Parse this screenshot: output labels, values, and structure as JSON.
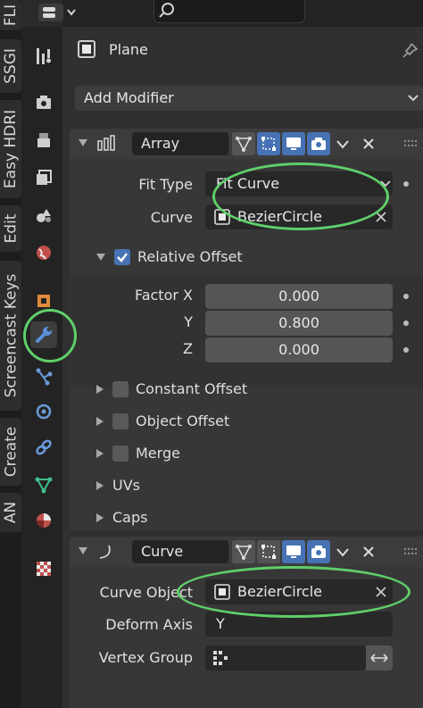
{
  "vertical_tabs": [
    {
      "label": "FLI"
    },
    {
      "label": "SSGI"
    },
    {
      "label": "Easy HDRI"
    },
    {
      "label": "Edit"
    },
    {
      "label": "Screencast Keys"
    },
    {
      "label": "Create"
    },
    {
      "label": "AN"
    }
  ],
  "properties_tabs": [
    "tool-icon",
    "render-icon",
    "output-icon",
    "view-layer-icon",
    "scene-icon",
    "world-icon",
    "object-icon",
    "modifier-wrench-icon",
    "particles-icon",
    "physics-icon",
    "constraints-icon",
    "object-data-icon",
    "material-icon",
    "texture-icon"
  ],
  "active_tab": "modifier-wrench-icon",
  "object": {
    "name": "Plane"
  },
  "add_modifier_label": "Add Modifier",
  "array_modifier": {
    "name": "Array",
    "fit_type_label": "Fit Type",
    "fit_type_value": "Fit Curve",
    "curve_label": "Curve",
    "curve_value": "BezierCircle",
    "relative_offset_label": "Relative Offset",
    "relative_offset_checked": true,
    "factor_x_label": "Factor X",
    "factor_x": "0.000",
    "y_label": "Y",
    "factor_y": "0.800",
    "z_label": "Z",
    "factor_z": "0.000",
    "subpanels": [
      {
        "label": "Constant Offset",
        "checkbox": true
      },
      {
        "label": "Object Offset",
        "checkbox": true
      },
      {
        "label": "Merge",
        "checkbox": true
      },
      {
        "label": "UVs",
        "checkbox": false
      },
      {
        "label": "Caps",
        "checkbox": false
      }
    ]
  },
  "curve_modifier": {
    "name": "Curve",
    "curve_object_label": "Curve Object",
    "curve_object_value": "BezierCircle",
    "deform_axis_label": "Deform Axis",
    "deform_axis_value": "Y",
    "vertex_group_label": "Vertex Group",
    "vertex_group_value": ""
  },
  "colors": {
    "accent": "#4772b3",
    "highlight_circle": "#5fcf6a",
    "panel": "#3c3c3c",
    "background": "#303030"
  }
}
